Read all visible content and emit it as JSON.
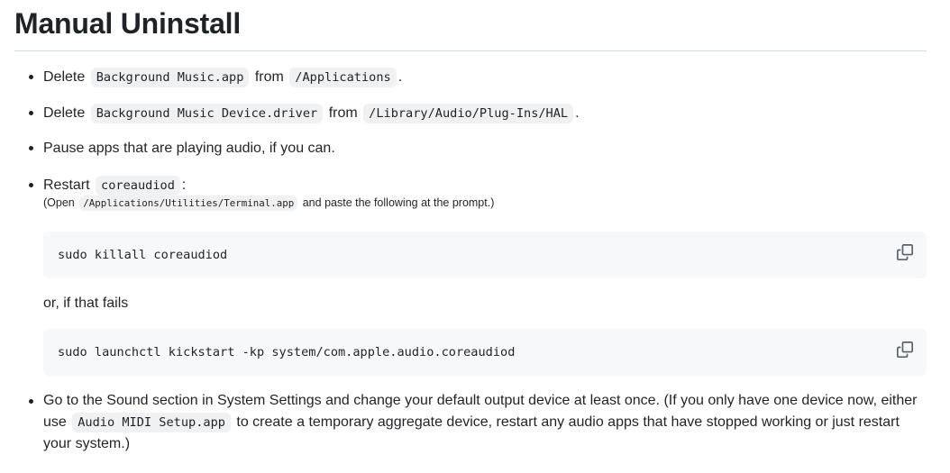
{
  "heading": "Manual Uninstall",
  "items": {
    "i1": {
      "pre": "Delete",
      "code1": "Background Music.app",
      "mid": "from",
      "code2": "/Applications",
      "post": "."
    },
    "i2": {
      "pre": "Delete",
      "code1": "Background Music Device.driver",
      "mid": "from",
      "code2": "/Library/Audio/Plug-Ins/HAL",
      "post": "."
    },
    "i3": {
      "text": "Pause apps that are playing audio, if you can."
    },
    "i4": {
      "pre": "Restart",
      "code": "coreaudiod",
      "post": ":",
      "note_pre": "(Open",
      "note_code": "/Applications/Utilities/Terminal.app",
      "note_post": "and paste the following at the prompt.)"
    },
    "i5": {
      "pre": "Go to the Sound section in System Settings and change your default output device at least once. (If you only have one device now, either use",
      "code": "Audio MIDI Setup.app",
      "post": "to create a temporary aggregate device, restart any audio apps that have stopped working or just restart your system.)"
    }
  },
  "code_blocks": {
    "kill": "sudo killall coreaudiod",
    "kickstart": "sudo launchctl kickstart -kp system/com.apple.audio.coreaudiod"
  },
  "or_text": "or, if that fails",
  "icons": {
    "copy": "copy-icon"
  }
}
